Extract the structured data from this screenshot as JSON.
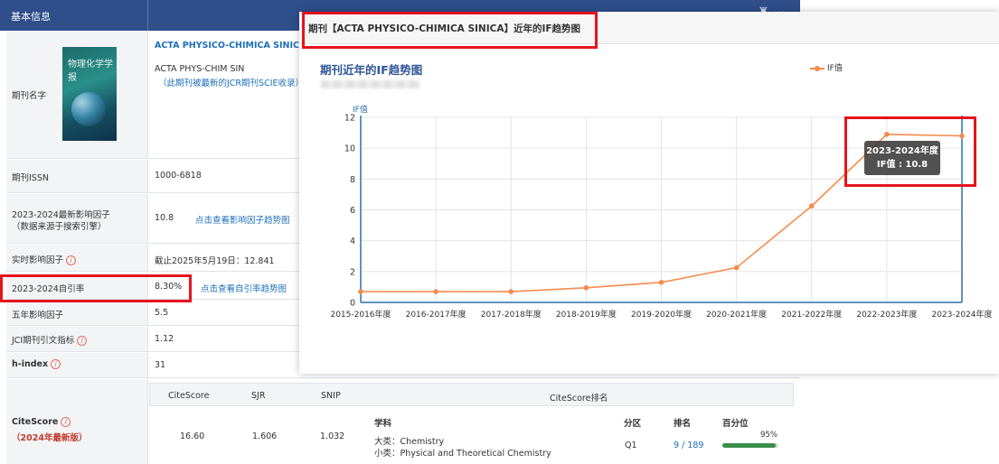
{
  "info": {
    "header_title": "基本信息",
    "journal_name_label": "期刊名字",
    "journal_name_full": "ACTA PHYSICO-CHIMICA SINICA",
    "journal_name_abbr": "ACTA PHYS-CHIM SIN",
    "journal_note": "（此期刊被最新的JCR期刊SCIE收录）",
    "cover_text": "物理化学学报",
    "issn_label": "期刊ISSN",
    "issn_value": "1000-6818",
    "if_label_line1": "2023-2024最新影响因子",
    "if_label_line2": "（数据来源于搜索引擎）",
    "if_value": "10.8",
    "if_link": "点击查看影响因子趋势图",
    "realtime_if_label": "实时影响因子",
    "realtime_if_value": "截止2025年5月19日：12.841",
    "self_cite_label": "2023-2024自引率",
    "self_cite_value": "8.30%",
    "self_cite_link": "点击查看自引率趋势图",
    "five_year_label": "五年影响因子",
    "five_year_value": "5.5",
    "jci_label": "JCI期刊引文指标",
    "jci_value": "1.12",
    "hindex_label": "h-index",
    "hindex_value": "31",
    "citescore_label": "CiteScore",
    "citescore_sub": "（2024年最新版）",
    "citescore_table": {
      "headers": [
        "CiteScore",
        "SJR",
        "SNIP",
        "CiteScore排名"
      ],
      "subheaders": [
        "学科",
        "分区",
        "排名",
        "百分位"
      ],
      "citescore": "16.60",
      "sjr": "1.606",
      "snip": "1.032",
      "major": "大类：Chemistry",
      "minor": "小类：Physical and Theoretical Chemistry",
      "quartile": "Q1",
      "rank": "9 / 189",
      "percentile": "95%",
      "percentile_fraction": 0.95
    }
  },
  "modal": {
    "title": "期刊【ACTA PHYSICO-CHIMICA SINICA】近年的IF趋势图",
    "chart_title": "期刊近年的IF趋势图",
    "legend": "IF值",
    "tooltip_line1": "2023-2024年度",
    "tooltip_line2": "IF值 : 10.8"
  },
  "colors": {
    "header": "#2f4e8a",
    "line": "#f58b4c",
    "highlight": "#e4141d",
    "link": "#1d6fb8"
  },
  "chart_data": {
    "type": "line",
    "ylabel": "IF值",
    "categories": [
      "2015-2016年度",
      "2016-2017年度",
      "2017-2018年度",
      "2018-2019年度",
      "2019-2020年度",
      "2020-2021年度",
      "2021-2022年度",
      "2022-2023年度",
      "2023-2024年度"
    ],
    "series": [
      {
        "name": "IF值",
        "values": [
          0.7,
          0.7,
          0.7,
          0.95,
          1.3,
          2.25,
          6.25,
          10.9,
          10.8
        ]
      }
    ],
    "ylim": [
      0,
      12
    ],
    "yticks": [
      0,
      2,
      4,
      6,
      8,
      10,
      12
    ],
    "grid": true,
    "legend": "top-right"
  }
}
